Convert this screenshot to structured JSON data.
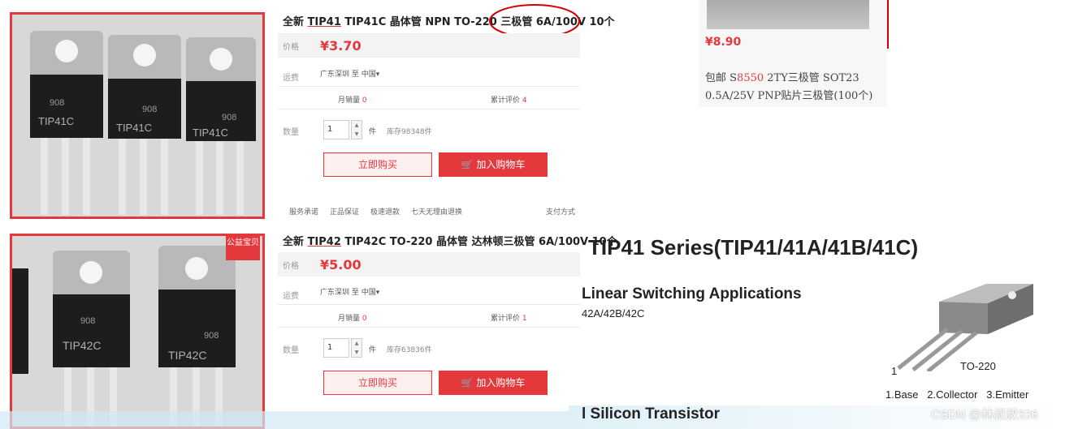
{
  "products": [
    {
      "title_prefix": "全新",
      "title_model": "TIP41",
      "title_rest": " TIP41C 晶体管 NPN TO-220 三极管 6A/100V 10个",
      "price_label": "价格",
      "price": "¥3.70",
      "shipping_label": "运费",
      "shipping_value": "广东深圳 至 中国",
      "monthly_sales_label": "月销量",
      "monthly_sales": "0",
      "reviews_label": "累计评价",
      "reviews": "4",
      "qty_label": "数量",
      "qty_value": "1",
      "qty_unit": "件",
      "stock": "库存98348件",
      "buy_label": "立即购买",
      "cart_label": "加入购物车",
      "service_label": "服务承诺",
      "services": [
        "正品保证",
        "极速退款",
        "七天无理由退换"
      ],
      "payment_label": "支付方式",
      "chip_marking": "TIP41C",
      "chip_code": "908"
    },
    {
      "title_prefix": "全新",
      "title_model": "TIP42",
      "title_rest": " TIP42C TO-220 晶体管 达林顿三极管 6A/100V 10个",
      "price_label": "价格",
      "price": "¥5.00",
      "shipping_label": "运费",
      "shipping_value": "广东深圳 至 中国",
      "monthly_sales_label": "月销量",
      "monthly_sales": "0",
      "reviews_label": "累计评价",
      "reviews": "1",
      "qty_label": "数量",
      "qty_value": "1",
      "qty_unit": "件",
      "stock": "库存63836件",
      "buy_label": "立即购买",
      "cart_label": "加入购物车",
      "badge": "公益宝贝",
      "chip_marking": "TIP42C",
      "chip_code": "908"
    }
  ],
  "related_item": {
    "price": "¥8.90",
    "title_line1_prefix": "包邮 S",
    "title_line1_highlight": "8550",
    "title_line1_rest": " 2TY三极管 SOT23",
    "title_line2": "0.5A/25V PNP贴片三极管(100个)"
  },
  "datasheet": {
    "title": "TIP41 Series(TIP41/41A/41B/41C)",
    "subtitle": "Linear Switching Applications",
    "variants": "42A/42B/42C",
    "package": "TO-220",
    "pin1_num": "1",
    "pins": "1.Base   2.Collector   3.Emitter",
    "footer": "l Silicon Transistor"
  },
  "watermark": "CSDN @林叔叔336",
  "colors": {
    "accent": "#e4393c",
    "annotation": "#d40000"
  }
}
